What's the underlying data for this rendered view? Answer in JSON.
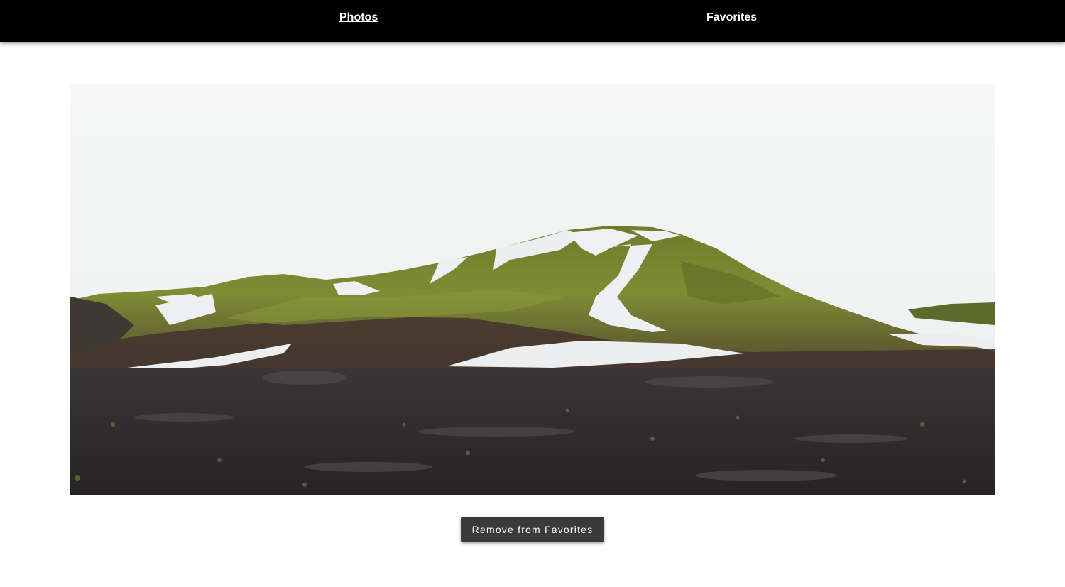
{
  "nav": {
    "items": [
      {
        "label": "Photos",
        "active": true
      },
      {
        "label": "Favorites",
        "active": false
      }
    ]
  },
  "photo": {
    "subject": "moss-covered mountain with snow patches over dark volcanic plain",
    "colors": {
      "sky": "#f3f4f4",
      "moss": "#7d8a32",
      "moss_dark": "#4d5a22",
      "slope_brown": "#3f2f2c",
      "snow": "#eef0f1",
      "ground": "#2c2a2b"
    }
  },
  "actions": {
    "remove_label": "Remove from Favorites"
  },
  "theme": {
    "navbar_bg": "#000000",
    "button_bg": "#3a3a3a",
    "text_light": "#ffffff"
  }
}
